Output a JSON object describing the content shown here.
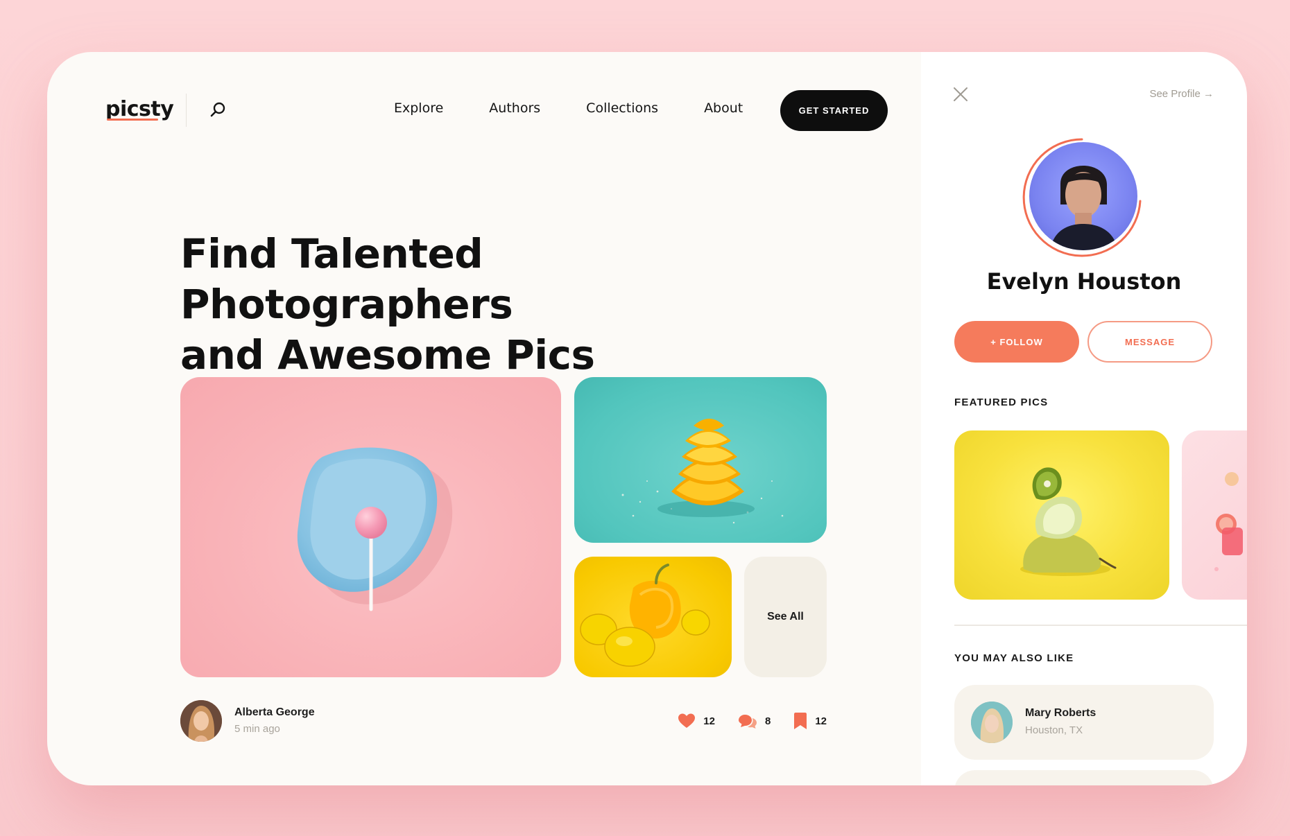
{
  "brand": {
    "logo": "picsty"
  },
  "nav": {
    "items": [
      "Explore",
      "Authors",
      "Collections",
      "About"
    ],
    "cta": "GET STARTED"
  },
  "hero": {
    "line1": "Find Talented Photographers",
    "line2": "and Awesome Pics"
  },
  "gallery": {
    "see_all": "See All"
  },
  "post": {
    "author": "Alberta George",
    "time": "5 min ago",
    "likes": "12",
    "comments": "8",
    "saves": "12"
  },
  "profile": {
    "see_profile": "See Profile →",
    "name": "Evelyn Houston",
    "follow": "+ FOLLOW",
    "message": "MESSAGE",
    "featured_title": "FEATURED PICS",
    "also_like_title": "YOU MAY ALSO LIKE",
    "suggestions": [
      {
        "name": "Mary Roberts",
        "location": "Houston, TX"
      }
    ]
  },
  "colors": {
    "accent": "#f26d51",
    "background": "#fcfaf7",
    "page": "#fdd5d7"
  },
  "icons": [
    "search-icon",
    "close-icon",
    "heart-icon",
    "comment-icon",
    "bookmark-icon"
  ]
}
